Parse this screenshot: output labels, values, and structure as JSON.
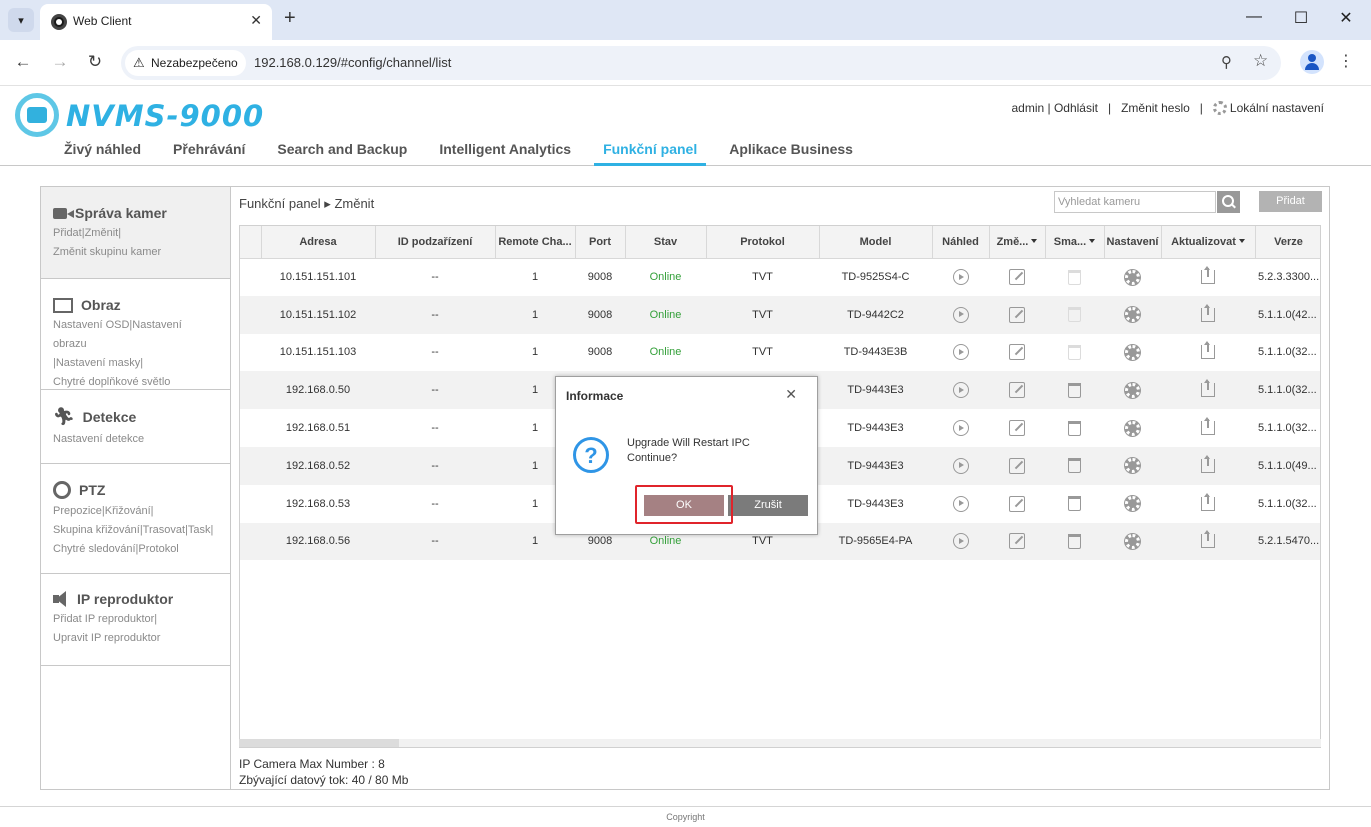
{
  "browser": {
    "tab_title": "Web Client",
    "security_label": "Nezabezpečeno",
    "url": "192.168.0.129/#config/channel/list"
  },
  "app": {
    "logo_text": "NVMS-9000",
    "user_links": [
      "admin | Odhlásit",
      "Změnit heslo",
      "Lokální nastavení"
    ],
    "nav": [
      "Živý náhled",
      "Přehrávání",
      "Search and Backup",
      "Intelligent Analytics",
      "Funkční panel",
      "Aplikace Business"
    ],
    "nav_active": "Funkční panel"
  },
  "sidebar": {
    "sections": [
      {
        "title": "Správa kamer",
        "icon": "camera-icon",
        "lines": [
          "Přidat|Změnit|",
          "Změnit skupinu kamer"
        ]
      },
      {
        "title": "Obraz",
        "icon": "image-icon",
        "lines": [
          "Nastavení OSD|Nastavení obrazu",
          "|Nastavení masky|",
          "Chytré doplňkové světlo"
        ]
      },
      {
        "title": "Detekce",
        "icon": "running-man-icon",
        "lines": [
          "Nastavení detekce"
        ]
      },
      {
        "title": "PTZ",
        "icon": "ptz-camera-icon",
        "lines": [
          "Prepozice|Křižování|",
          "Skupina křižování|Trasovat|Task|",
          "Chytré sledování|Protokol"
        ]
      },
      {
        "title": "IP reproduktor",
        "icon": "speaker-icon",
        "lines": [
          "Přidat IP reproduktor|",
          "Upravit IP reproduktor"
        ]
      }
    ]
  },
  "main": {
    "breadcrumb_root": "Funkční panel",
    "breadcrumb_sep": "▸",
    "breadcrumb_leaf": "Změnit",
    "search_placeholder": "Vyhledat kameru",
    "add_label": "Přidat",
    "columns": [
      "Adresa",
      "ID podzařízení",
      "Remote Cha...",
      "Port",
      "Stav",
      "Protokol",
      "Model",
      "Náhled",
      "Změ...",
      "Sma...",
      "Nastavení",
      "Aktualizovat",
      "Verze"
    ],
    "rows": [
      {
        "address": "10.151.151.101",
        "subid": "--",
        "remote": "1",
        "port": "9008",
        "status": "Online",
        "protocol": "TVT",
        "model": "TD-9525S4-C",
        "version": "5.2.3.3300...",
        "delete_enabled": false
      },
      {
        "address": "10.151.151.102",
        "subid": "--",
        "remote": "1",
        "port": "9008",
        "status": "Online",
        "protocol": "TVT",
        "model": "TD-9442C2",
        "version": "5.1.1.0(42...",
        "delete_enabled": false
      },
      {
        "address": "10.151.151.103",
        "subid": "--",
        "remote": "1",
        "port": "9008",
        "status": "Online",
        "protocol": "TVT",
        "model": "TD-9443E3B",
        "version": "5.1.1.0(32...",
        "delete_enabled": false
      },
      {
        "address": "192.168.0.50",
        "subid": "--",
        "remote": "1",
        "port": "",
        "status": "",
        "protocol": "",
        "model": "TD-9443E3",
        "version": "5.1.1.0(32...",
        "delete_enabled": true
      },
      {
        "address": "192.168.0.51",
        "subid": "--",
        "remote": "1",
        "port": "",
        "status": "",
        "protocol": "",
        "model": "TD-9443E3",
        "version": "5.1.1.0(32...",
        "delete_enabled": true
      },
      {
        "address": "192.168.0.52",
        "subid": "--",
        "remote": "1",
        "port": "",
        "status": "",
        "protocol": "",
        "model": "TD-9443E3",
        "version": "5.1.1.0(49...",
        "delete_enabled": true
      },
      {
        "address": "192.168.0.53",
        "subid": "--",
        "remote": "1",
        "port": "",
        "status": "",
        "protocol": "",
        "model": "TD-9443E3",
        "version": "5.1.1.0(32...",
        "delete_enabled": true
      },
      {
        "address": "192.168.0.56",
        "subid": "--",
        "remote": "1",
        "port": "9008",
        "status": "Online",
        "protocol": "TVT",
        "model": "TD-9565E4-PA",
        "version": "5.2.1.5470...",
        "delete_enabled": true
      }
    ],
    "info_max": "IP Camera Max Number : 8",
    "info_bandwidth": "Zbývající datový tok: 40 / 80 Mb"
  },
  "dialog": {
    "title": "Informace",
    "close": "✕",
    "message_line1": "Upgrade Will Restart IPC",
    "message_line2": "Continue?",
    "ok_label": "OK",
    "cancel_label": "Zrušit"
  },
  "copyright": "Copyright",
  "colors": {
    "accent": "#2fb1e3",
    "online": "#34a03a",
    "ok_button": "#a58183",
    "highlight": "#e0242b"
  }
}
